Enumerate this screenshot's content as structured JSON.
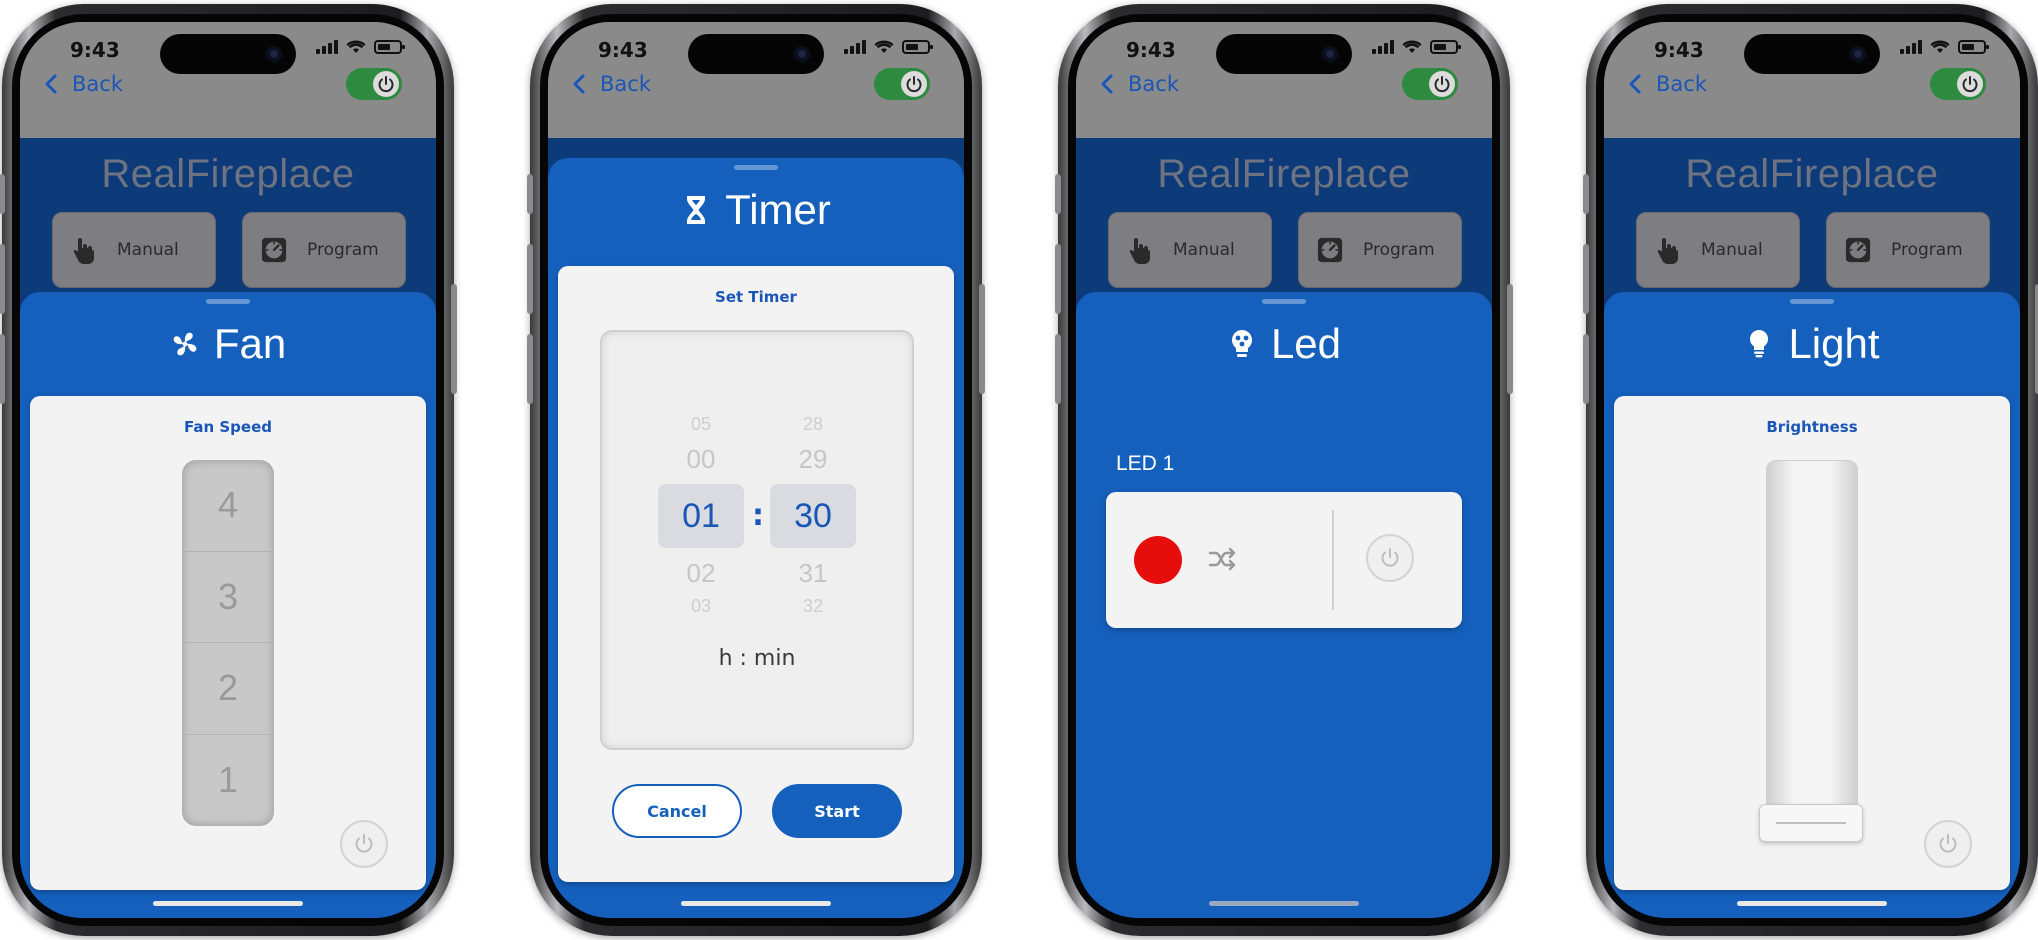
{
  "status": {
    "time": "9:43"
  },
  "nav": {
    "back_label": "Back"
  },
  "brand": "RealFireplace",
  "mode_buttons": {
    "manual": "Manual",
    "program": "Program"
  },
  "fan": {
    "title": "Fan",
    "card_label": "Fan Speed",
    "speeds": [
      "4",
      "3",
      "2",
      "1"
    ]
  },
  "timer": {
    "title": "Timer",
    "card_label": "Set Timer",
    "hours": {
      "prev2": "05",
      "prev": "00",
      "selected": "01",
      "next": "02",
      "next2": "03"
    },
    "minutes": {
      "prev2": "28",
      "prev": "29",
      "selected": "30",
      "next": "31",
      "next2": "32"
    },
    "separator": ":",
    "unit_label": "h : min",
    "cancel_label": "Cancel",
    "start_label": "Start"
  },
  "led": {
    "title": "Led",
    "label": "LED 1",
    "color": "#e60d0d"
  },
  "light": {
    "title": "Light",
    "card_label": "Brightness",
    "brightness": 0
  },
  "colors": {
    "primary_blue": "#1560bd",
    "toggle_on": "#2d8a3e",
    "led_red": "#e60d0d"
  }
}
